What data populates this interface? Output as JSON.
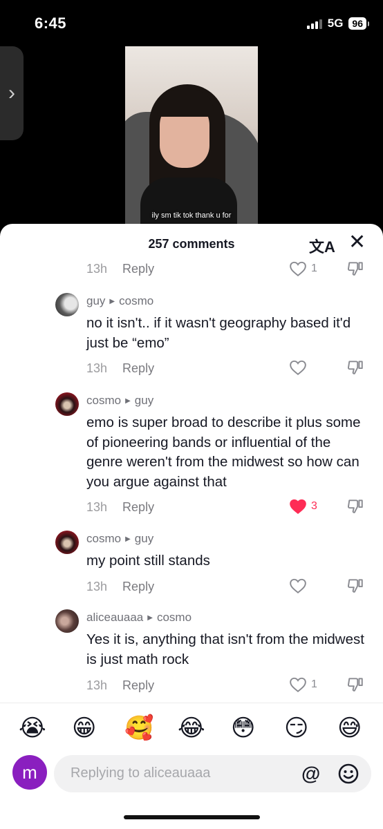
{
  "status_bar": {
    "time": "6:45",
    "network": "5G",
    "battery": "96"
  },
  "video": {
    "caption": "ily sm tik tok thank u for"
  },
  "sheet": {
    "title": "257 comments"
  },
  "comments": [
    {
      "kind": "tail",
      "time": "13h",
      "reply": "Reply",
      "likes": "1",
      "liked": false
    },
    {
      "author": "guy",
      "reply_to": "cosmo",
      "text": "no it isn't.. if it wasn't geography based it'd just be “emo”",
      "time": "13h",
      "reply": "Reply",
      "likes": "",
      "liked": false
    },
    {
      "author": "cosmo",
      "reply_to": "guy",
      "text": "emo is super broad to describe it plus some of pioneering bands or influential of the genre weren't from the midwest so how can you argue against that",
      "time": "13h",
      "reply": "Reply",
      "likes": "3",
      "liked": true
    },
    {
      "author": "cosmo",
      "reply_to": "guy",
      "text": "my point still stands",
      "time": "13h",
      "reply": "Reply",
      "likes": "",
      "liked": false
    },
    {
      "author": "aliceauaaa",
      "reply_to": "cosmo",
      "text": "Yes it is, anything that isn't from the midwest is just math rock",
      "time": "13h",
      "reply": "Reply",
      "likes": "1",
      "liked": false
    }
  ],
  "emojis": [
    "😭",
    "😁",
    "🥰",
    "😂",
    "😳",
    "😏",
    "😅"
  ],
  "compose": {
    "avatar_letter": "m",
    "placeholder": "Replying to aliceauaaa",
    "at_symbol": "@"
  },
  "icons": {
    "back": "chevron-right-icon",
    "translate": "translate-icon",
    "close": "close-icon",
    "like": "heart-icon",
    "dislike": "thumbs-down-icon",
    "emoji": "smile-icon"
  },
  "colors": {
    "liked_heart": "#fe2c55",
    "avatar_me": "#8a1fbf"
  }
}
